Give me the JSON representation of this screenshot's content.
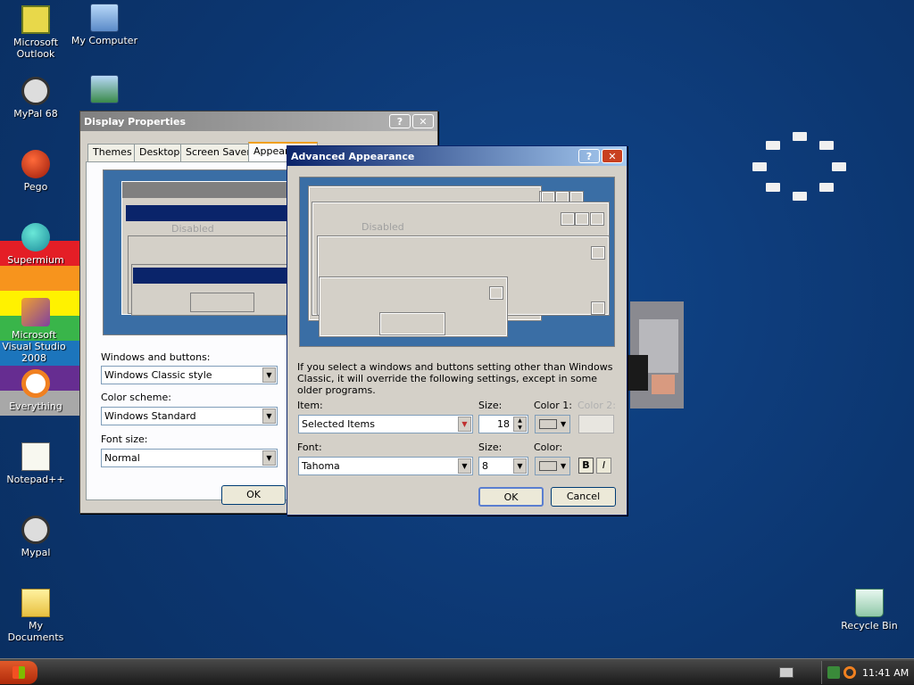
{
  "desktop": {
    "icons": [
      {
        "label": "Microsoft Outlook",
        "icon": "outlook-icon"
      },
      {
        "label": "My Computer",
        "icon": "computer-icon"
      },
      {
        "label": "MyPal 68",
        "icon": "mypal-icon"
      },
      {
        "label": "Pego",
        "icon": "pego-icon"
      },
      {
        "label": "Supermium",
        "icon": "supermium-icon"
      },
      {
        "label": "Microsoft Visual Studio 2008",
        "icon": "visual-studio-icon"
      },
      {
        "label": "Everything",
        "icon": "everything-icon"
      },
      {
        "label": "Notepad++",
        "icon": "notepad-icon"
      },
      {
        "label": "Mypal",
        "icon": "mypal-icon"
      },
      {
        "label": "My Documents",
        "icon": "documents-icon"
      },
      {
        "label": "Recycle Bin",
        "icon": "recycle-bin-icon"
      }
    ]
  },
  "display_properties": {
    "title": "Display Properties",
    "tabs": [
      "Themes",
      "Desktop",
      "Screen Saver",
      "Appearance"
    ],
    "preview_disabled": "Disabled",
    "windows_buttons_label": "Windows and buttons:",
    "windows_buttons_value": "Windows Classic style",
    "color_scheme_label": "Color scheme:",
    "color_scheme_value": "Windows Standard",
    "font_size_label": "Font size:",
    "font_size_value": "Normal",
    "ok_label": "OK"
  },
  "advanced_appearance": {
    "title": "Advanced Appearance",
    "preview_disabled": "Disabled",
    "info_text": "If you select a windows and buttons setting other than Windows Classic, it will override the following settings, except in some older programs.",
    "item_label": "Item:",
    "item_value": "Selected Items",
    "size_label": "Size:",
    "size_value": "18",
    "color1_label": "Color 1:",
    "color2_label": "Color 2:",
    "font_label": "Font:",
    "font_value": "Tahoma",
    "font_size_label": "Size:",
    "font_size_value": "8",
    "color_label": "Color:",
    "bold_label": "B",
    "italic_label": "I",
    "ok_label": "OK",
    "cancel_label": "Cancel"
  },
  "taskbar": {
    "clock": "11:41 AM"
  },
  "colors": {
    "desktop": "#0e3a74",
    "title_active": "#0a246a",
    "title_inactive": "#808080",
    "selection": "#0a246a"
  }
}
